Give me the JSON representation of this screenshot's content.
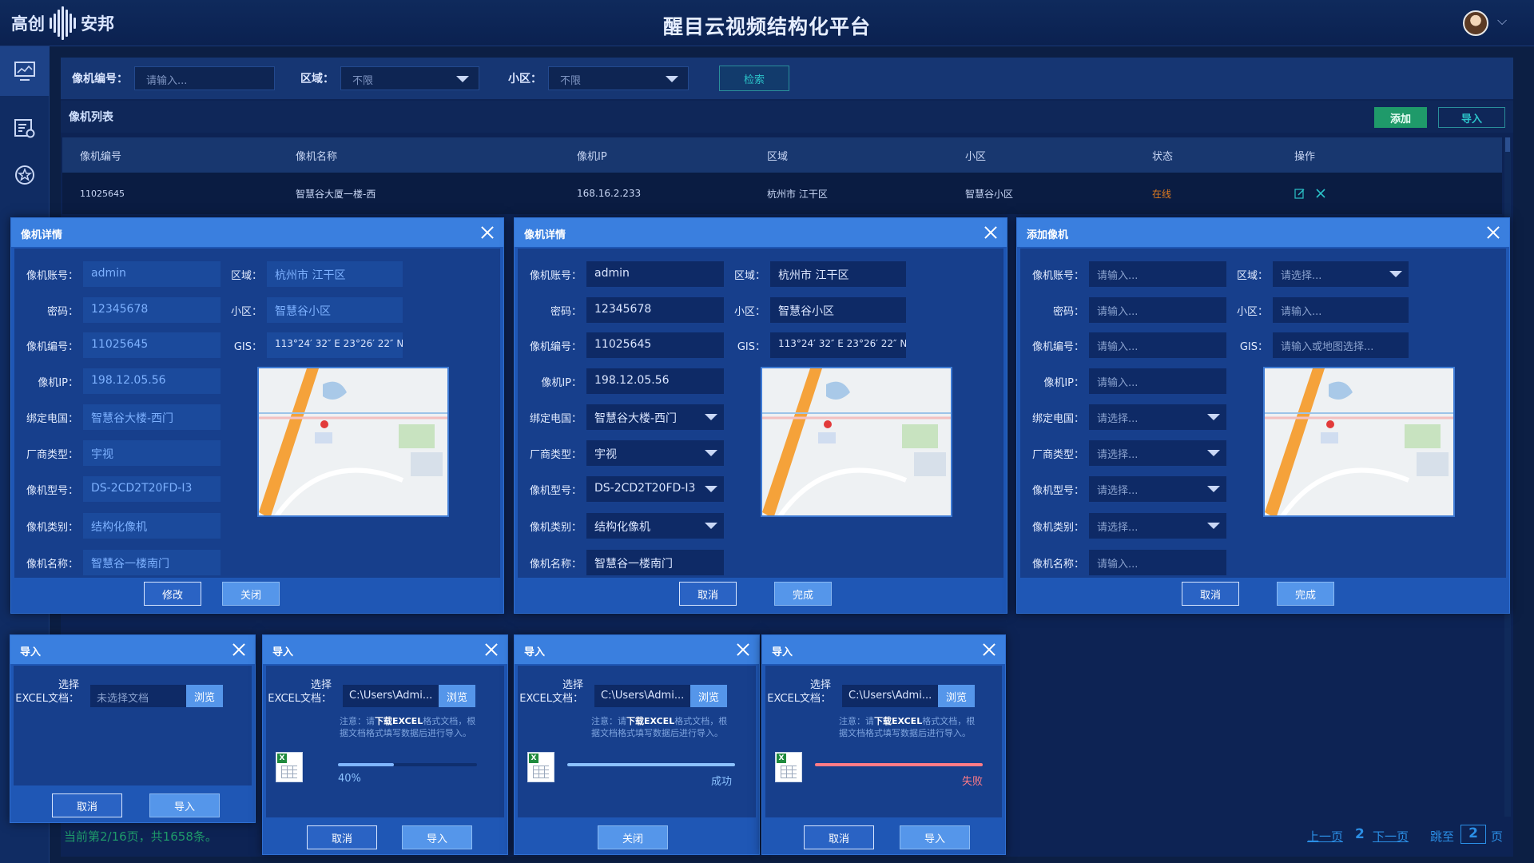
{
  "app": {
    "logo_text_1": "高创",
    "logo_text_2": "安邦",
    "title": "醒目云视频结构化平台"
  },
  "sidebar": {
    "items": [
      {
        "icon": "monitor-icon"
      },
      {
        "icon": "settings-list-icon"
      },
      {
        "icon": "badge-icon"
      }
    ]
  },
  "filter": {
    "id_label": "像机编号：",
    "id_placeholder": "请输入...",
    "area_label": "区域：",
    "area_value": "不限",
    "community_label": "小区：",
    "community_value": "不限",
    "search_label": "检索"
  },
  "list": {
    "title": "像机列表",
    "add_label": "添加",
    "import_label": "导入",
    "columns": [
      "像机编号",
      "像机名称",
      "像机IP",
      "区域",
      "小区",
      "状态",
      "操作"
    ],
    "rows": [
      {
        "id": "11025645",
        "name": "智慧谷大厦一楼-西",
        "ip": "168.16.2.233",
        "area": "杭州市 江干区",
        "community": "智慧谷小区",
        "status": "在线"
      }
    ],
    "status_color": "#e07b1e"
  },
  "detail_view": {
    "title": "像机详情",
    "labels": {
      "account": "像机账号：",
      "password": "密码：",
      "id": "像机编号：",
      "ip": "像机IP：",
      "pole": "绑定电国：",
      "vendor": "厂商类型：",
      "model": "像机型号：",
      "type": "像机类别：",
      "name": "像机名称：",
      "area": "区域：",
      "community": "小区：",
      "gis": "GIS："
    },
    "values": {
      "account": "admin",
      "password": "12345678",
      "id": "11025645",
      "ip": "198.12.05.56",
      "pole": "智慧谷大楼-西门",
      "vendor": "宇视",
      "model": "DS-2CD2T20FD-I3",
      "type": "结构化像机",
      "name": "智慧谷一楼南门",
      "area": "杭州市 江干区",
      "community": "智慧谷小区",
      "gis": "113°24′ 32″ E   23°26′ 22″ N"
    },
    "btn_edit": "修改",
    "btn_close": "关闭"
  },
  "detail_edit": {
    "title": "像机详情",
    "labels": {
      "account": "像机账号：",
      "password": "密码：",
      "id": "像机编号：",
      "ip": "像机IP：",
      "pole": "绑定电国：",
      "vendor": "厂商类型：",
      "model": "像机型号：",
      "type": "像机类别：",
      "name": "像机名称：",
      "area": "区域：",
      "community": "小区：",
      "gis": "GIS："
    },
    "values": {
      "account": "admin",
      "password": "12345678",
      "id": "11025645",
      "ip": "198.12.05.56",
      "pole": "智慧谷大楼-西门",
      "vendor": "宇视",
      "model": "DS-2CD2T20FD-I3",
      "type": "结构化像机",
      "name": "智慧谷一楼南门",
      "area": "杭州市 江干区",
      "community": "智慧谷小区",
      "gis": "113°24′ 32″ E   23°26′ 22″ N"
    },
    "btn_cancel": "取消",
    "btn_done": "完成"
  },
  "add_camera": {
    "title": "添加像机",
    "labels": {
      "account": "像机账号：",
      "password": "密码：",
      "id": "像机编号：",
      "ip": "像机IP：",
      "pole": "绑定电国：",
      "vendor": "厂商类型：",
      "model": "像机型号：",
      "type": "像机类别：",
      "name": "像机名称：",
      "area": "区域：",
      "community": "小区：",
      "gis": "GIS："
    },
    "placeholders": {
      "input": "请输入...",
      "select": "请选择...",
      "area": "请选择...",
      "gis": "请输入或地图选择..."
    },
    "btn_cancel": "取消",
    "btn_done": "完成"
  },
  "import": {
    "title": "导入",
    "choose_1": "选择",
    "choose_2": "EXCEL文档：",
    "empty_placeholder": "未选择文档",
    "file_path": "C:\\Users\\Admi...",
    "browse": "浏览",
    "note_prefix": "注意：请",
    "note_bold": "下载EXCEL",
    "note_suffix": "格式文档，根",
    "note_line2": "据文档格式填写数据后进行导入。",
    "progress": 0.4,
    "progress_text": "40%",
    "success_text": "成功",
    "fail_text": "失败",
    "btn_cancel": "取消",
    "btn_import": "导入",
    "btn_close": "关闭",
    "colors": {
      "progress": "#7fb6ff",
      "success": "#8cc2ff",
      "fail": "#ff7b86"
    }
  },
  "pager": {
    "summary": "当前第2/16页，共1658条。",
    "prev": "上一页",
    "current": "2",
    "next": "下一页",
    "jump_label": "跳至",
    "jump_value": "2",
    "page_unit": "页"
  }
}
